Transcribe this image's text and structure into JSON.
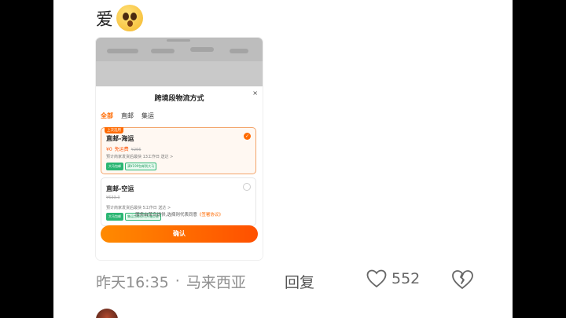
{
  "post": {
    "text": "爱"
  },
  "embedded": {
    "sheet_title": "跨境段物流方式",
    "close_glyph": "×",
    "tabs": [
      "全部",
      "直邮",
      "集运"
    ],
    "options": [
      {
        "tag": "上次选用",
        "name": "直邮-海运",
        "price": "¥0",
        "price_note": "免运费",
        "old_price": "¥266",
        "eta": "预计商家发货后最快 13工作日 送达 >",
        "badges": [
          "大马包邮",
          "满¥199包邮到大马"
        ]
      },
      {
        "name": "直邮-空运",
        "old_price": "¥633.3",
        "eta": "预计商家发货后最快 5工作日 送达 >",
        "badges": [
          "大马包邮",
          "集运包邮仅可开箱交收"
        ]
      }
    ],
    "footer_note_prefix": "服务由菜鸟提供,选择则代表同意",
    "footer_note_link": "《签署协议》",
    "confirm_label": "确认"
  },
  "meta": {
    "time": "昨天16:35",
    "separator": "·",
    "location": "马来西亚",
    "reply_label": "回复",
    "like_count": "552"
  },
  "colors": {
    "accent": "#ff6a00",
    "green": "#2bb673"
  }
}
